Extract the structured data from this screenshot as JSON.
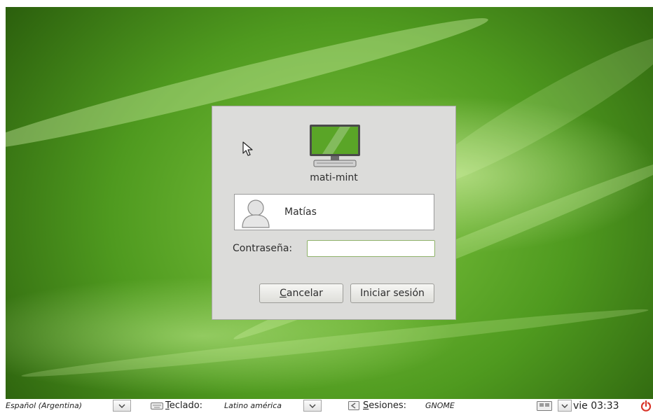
{
  "login": {
    "hostname": "mati-mint",
    "user_name": "Matías",
    "password_label": "Contraseña:",
    "password_value": "",
    "cancel_label_mnemonic": "C",
    "cancel_label_rest": "ancelar",
    "login_label": "Iniciar sesión"
  },
  "taskbar": {
    "language": "Español (Argentina)",
    "keyboard_label_mnemonic": "T",
    "keyboard_label_rest": "eclado:",
    "keyboard_value": "Latino américa",
    "sessions_label_mnemonic": "S",
    "sessions_label_rest": "esiones:",
    "sessions_value": "GNOME",
    "clock": "vie 03:33"
  },
  "icons": {
    "cursor": "arrow-cursor-icon",
    "computer": "computer-icon",
    "avatar": "user-avatar-icon",
    "keyboard": "keyboard-icon",
    "sessions": "sessions-icon",
    "screen": "screen-icon",
    "power": "power-icon"
  },
  "colors": {
    "accent_green": "#5aa527",
    "power_red": "#d8352a",
    "dialog_bg": "#dcdcda"
  }
}
